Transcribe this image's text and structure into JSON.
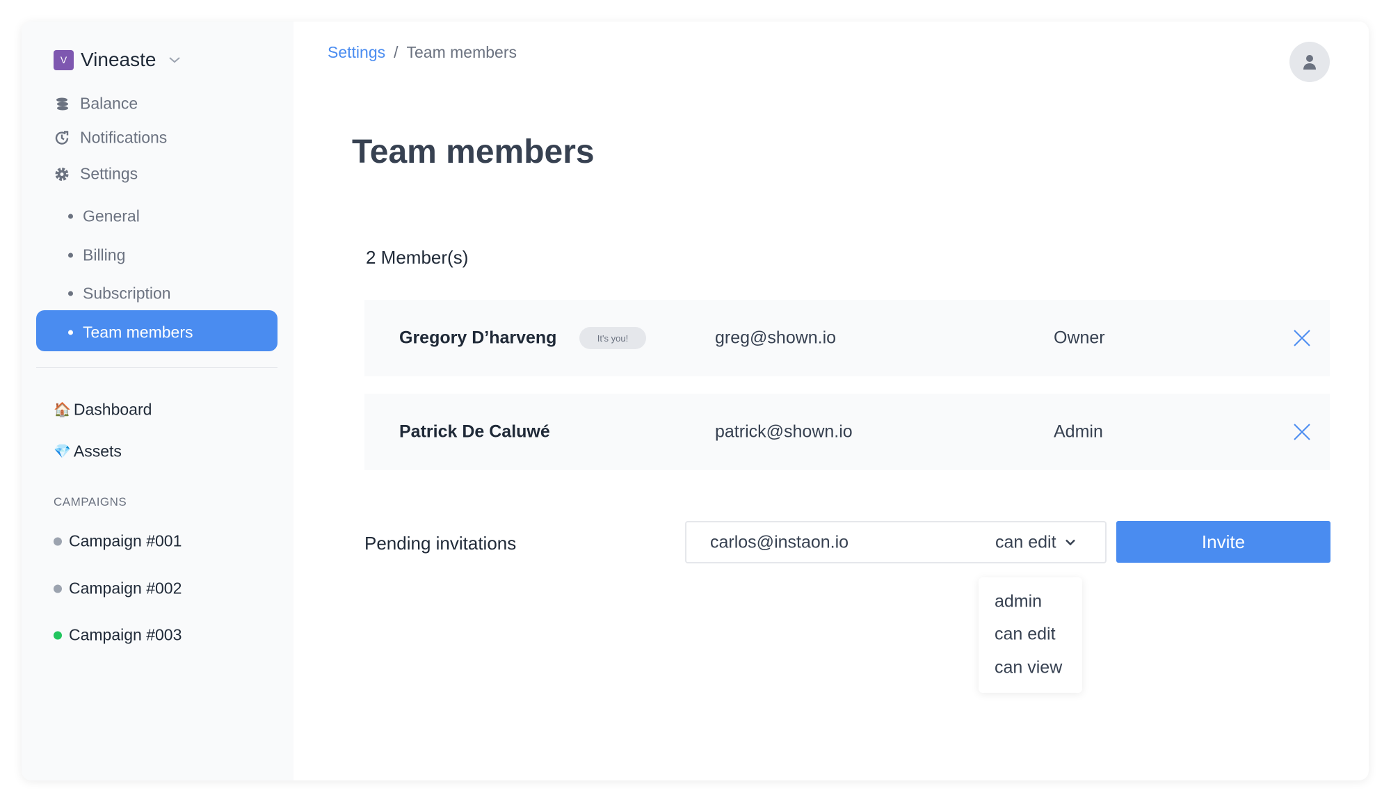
{
  "workspace": {
    "logo_letter": "V",
    "name": "Vineaste",
    "logo_color": "#7e57b0"
  },
  "sidebar": {
    "items": [
      {
        "label": "Balance",
        "icon": "coins-icon"
      },
      {
        "label": "Notifications",
        "icon": "clock-refresh-icon"
      },
      {
        "label": "Settings",
        "icon": "gear-icon"
      }
    ],
    "settings_sub": [
      {
        "label": "General"
      },
      {
        "label": "Billing"
      },
      {
        "label": "Subscription"
      },
      {
        "label": "Team members",
        "active": true
      }
    ],
    "links": [
      {
        "emoji": "🏠",
        "label": "Dashboard"
      },
      {
        "emoji": "💎",
        "label": "Assets"
      }
    ],
    "campaigns_heading": "CAMPAIGNS",
    "campaigns": [
      {
        "label": "Campaign #001",
        "status_color": "#9ca3af"
      },
      {
        "label": "Campaign #002",
        "status_color": "#9ca3af"
      },
      {
        "label": "Campaign #003",
        "status_color": "#22c55e"
      }
    ]
  },
  "breadcrumb": {
    "parent": "Settings",
    "separator": "/",
    "current": "Team members"
  },
  "page": {
    "title": "Team members",
    "member_count": "2 Member(s)"
  },
  "members": [
    {
      "name": "Gregory D’harveng",
      "badge": "It's you!",
      "email": "greg@shown.io",
      "role": "Owner"
    },
    {
      "name": "Patrick De Caluwé",
      "badge": null,
      "email": "patrick@shown.io",
      "role": "Admin"
    }
  ],
  "invite": {
    "label": "Pending invitations",
    "email_value": "carlos@instaon.io",
    "permission": "can edit",
    "button": "Invite",
    "options": [
      "admin",
      "can edit",
      "can view"
    ]
  },
  "colors": {
    "accent": "#4a8cf0",
    "text": "#374151",
    "muted": "#6b7280"
  }
}
